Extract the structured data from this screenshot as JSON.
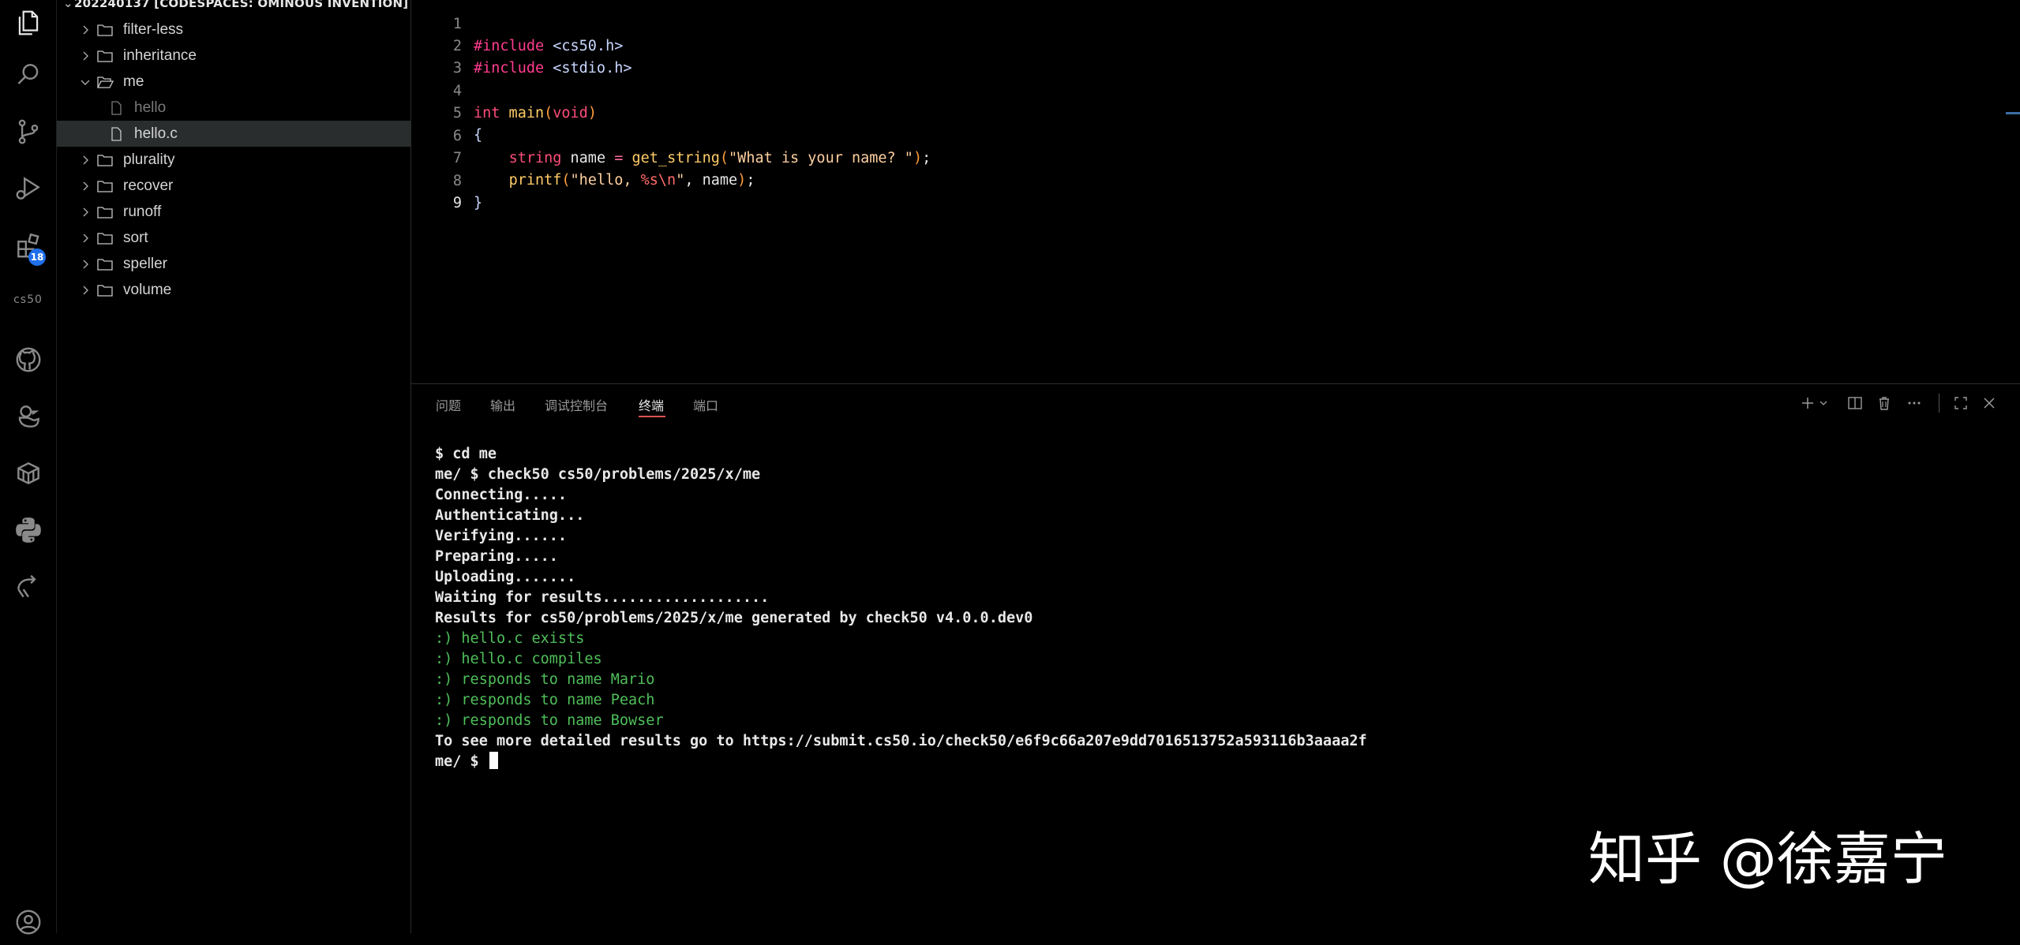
{
  "activity_bar": {
    "extensions_badge": "18",
    "cs50_label": "cs50"
  },
  "explorer": {
    "workspace_title": "202240137 [CODESPACES: OMINOUS INVENTION]",
    "items": [
      {
        "label": "filter-less",
        "type": "folder",
        "expanded": false
      },
      {
        "label": "inheritance",
        "type": "folder",
        "expanded": false
      },
      {
        "label": "me",
        "type": "folder",
        "expanded": true
      },
      {
        "label": "hello",
        "type": "file"
      },
      {
        "label": "hello.c",
        "type": "file",
        "selected": true
      },
      {
        "label": "plurality",
        "type": "folder",
        "expanded": false
      },
      {
        "label": "recover",
        "type": "folder",
        "expanded": false
      },
      {
        "label": "runoff",
        "type": "folder",
        "expanded": false
      },
      {
        "label": "sort",
        "type": "folder",
        "expanded": false
      },
      {
        "label": "speller",
        "type": "folder",
        "expanded": false
      },
      {
        "label": "volume",
        "type": "folder",
        "expanded": false
      }
    ]
  },
  "editor": {
    "line_numbers": [
      "1",
      "2",
      "3",
      "4",
      "5",
      "6",
      "7",
      "8",
      "9"
    ],
    "current_line": "9",
    "lines": {
      "l1_pre": "#include",
      "l1_inc": " <cs50.h>",
      "l2_pre": "#include",
      "l2_inc": " <stdio.h>",
      "l4_type": "int",
      "l4_fn": " main",
      "l4_p1": "(",
      "l4_void": "void",
      "l4_p2": ")",
      "l5": "{",
      "l6_indent": "    ",
      "l6_type": "string",
      "l6_var": " name",
      "l6_op": " =",
      "l6_fn": " get_string",
      "l6_p1": "(",
      "l6_str": "\"What is your name? \"",
      "l6_p2": ")",
      "l6_end": ";",
      "l7_indent": "    ",
      "l7_fn": "printf",
      "l7_p1": "(",
      "l7_str1": "\"hello, ",
      "l7_esc": "%s\\n",
      "l7_str2": "\"",
      "l7_rest": ", name",
      "l7_p2": ")",
      "l7_end": ";",
      "l8": "}"
    }
  },
  "panel": {
    "tabs": [
      "问题",
      "输出",
      "调试控制台",
      "终端",
      "端口"
    ],
    "active_tab": "终端",
    "terminal_lines": [
      {
        "text": "$ cd me",
        "kind": "normal"
      },
      {
        "text": "me/ $ check50 cs50/problems/2025/x/me",
        "kind": "normal"
      },
      {
        "text": "Connecting.....",
        "kind": "normal"
      },
      {
        "text": "Authenticating...",
        "kind": "normal"
      },
      {
        "text": "Verifying......",
        "kind": "normal"
      },
      {
        "text": "Preparing.....",
        "kind": "normal"
      },
      {
        "text": "Uploading.......",
        "kind": "normal"
      },
      {
        "text": "Waiting for results...................",
        "kind": "normal"
      },
      {
        "text": "Results for cs50/problems/2025/x/me generated by check50 v4.0.0.dev0",
        "kind": "normal"
      },
      {
        "text": ":) hello.c exists",
        "kind": "ok"
      },
      {
        "text": ":) hello.c compiles",
        "kind": "ok"
      },
      {
        "text": ":) responds to name Mario",
        "kind": "ok"
      },
      {
        "text": ":) responds to name Peach",
        "kind": "ok"
      },
      {
        "text": ":) responds to name Bowser",
        "kind": "ok"
      },
      {
        "text": "To see more detailed results go to https://submit.cs50.io/check50/e6f9c66a207e9dd7016513752a593116b3aaaa2f",
        "kind": "normal"
      }
    ],
    "prompt": "me/ $"
  },
  "watermark": "知乎 @徐嘉宁",
  "colors": {
    "background": "#000000",
    "terminal_ok": "#4fbf5a",
    "active_tab_underline": "#e05050",
    "badge": "#1f6feb"
  }
}
